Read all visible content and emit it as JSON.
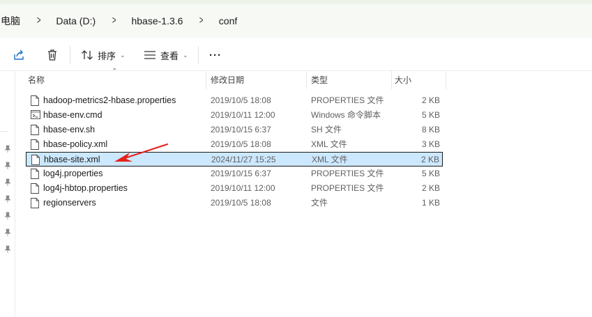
{
  "breadcrumb": [
    "电脑",
    "Data (D:)",
    "hbase-1.3.6",
    "conf"
  ],
  "toolbar": {
    "sort_label": "排序",
    "view_label": "查看",
    "more_label": "···"
  },
  "columns": {
    "name": "名称",
    "date": "修改日期",
    "type": "类型",
    "size": "大小"
  },
  "files": [
    {
      "name": "hadoop-metrics2-hbase.properties",
      "date": "2019/10/5 18:08",
      "type": "PROPERTIES 文件",
      "size": "2 KB",
      "icon": "document-icon"
    },
    {
      "name": "hbase-env.cmd",
      "date": "2019/10/11 12:00",
      "type": "Windows 命令脚本",
      "size": "5 KB",
      "icon": "script-icon"
    },
    {
      "name": "hbase-env.sh",
      "date": "2019/10/15 6:37",
      "type": "SH 文件",
      "size": "8 KB",
      "icon": "document-icon"
    },
    {
      "name": "hbase-policy.xml",
      "date": "2019/10/5 18:08",
      "type": "XML 文件",
      "size": "3 KB",
      "icon": "document-icon"
    },
    {
      "name": "hbase-site.xml",
      "date": "2024/11/27 15:25",
      "type": "XML 文件",
      "size": "2 KB",
      "icon": "document-icon"
    },
    {
      "name": "log4j.properties",
      "date": "2019/10/15 6:37",
      "type": "PROPERTIES 文件",
      "size": "5 KB",
      "icon": "document-icon"
    },
    {
      "name": "log4j-hbtop.properties",
      "date": "2019/10/11 12:00",
      "type": "PROPERTIES 文件",
      "size": "2 KB",
      "icon": "document-icon"
    },
    {
      "name": "regionservers",
      "date": "2019/10/5 18:08",
      "type": "文件",
      "size": "1 KB",
      "icon": "document-icon"
    }
  ],
  "selected_index": 4,
  "colors": {
    "selection": "#cce8ff",
    "annotation_arrow": "#e8201a"
  }
}
